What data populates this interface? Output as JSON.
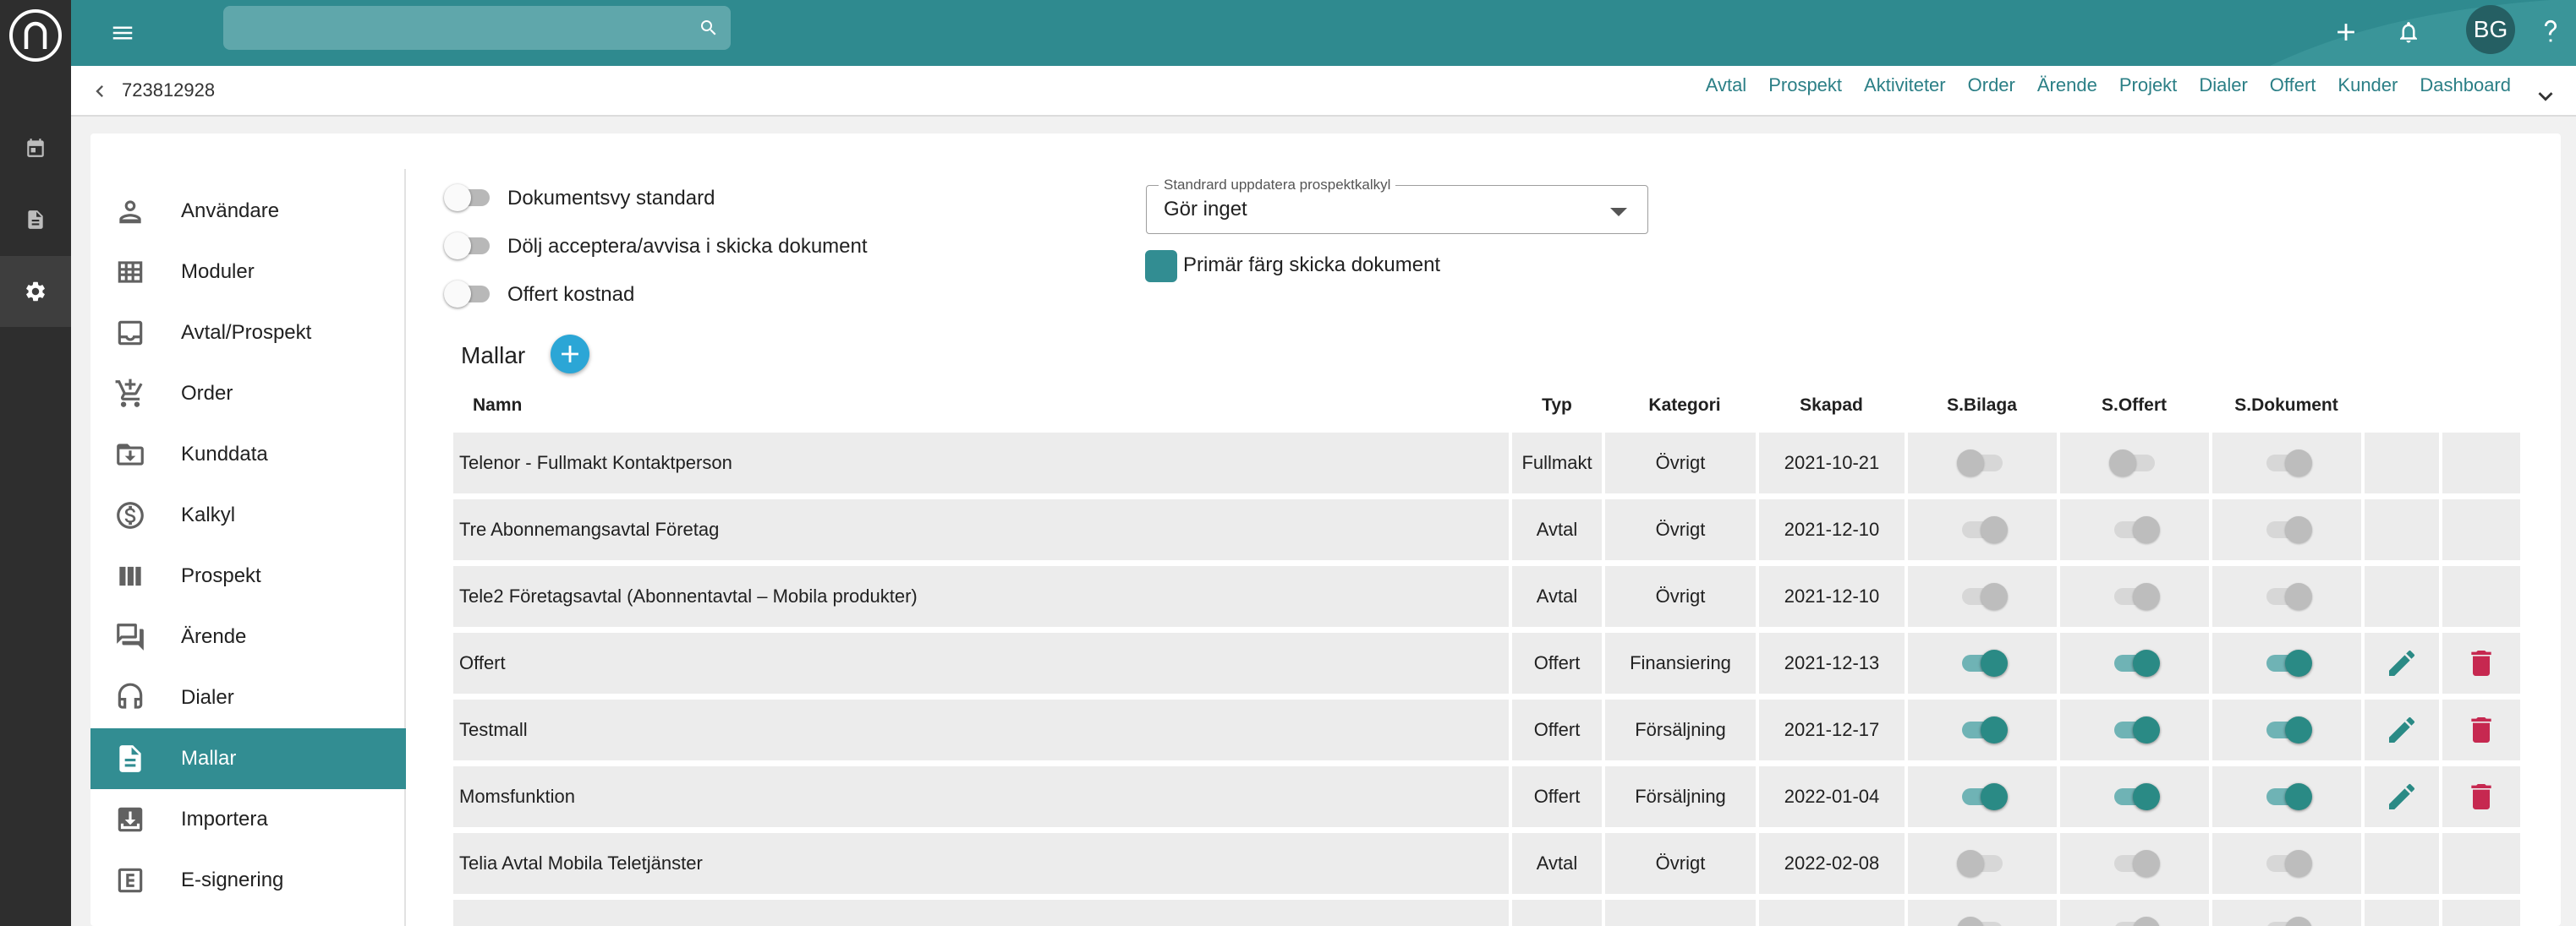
{
  "search": {
    "placeholder": ""
  },
  "user": {
    "initials": "BG"
  },
  "record": {
    "id": "723812928"
  },
  "nav_links": [
    "Avtal",
    "Prospekt",
    "Aktiviteter",
    "Order",
    "Ärende",
    "Projekt",
    "Dialer",
    "Offert",
    "Kunder",
    "Dashboard"
  ],
  "settings_nav": [
    {
      "label": "Användare",
      "icon": "person-icon"
    },
    {
      "label": "Moduler",
      "icon": "grid-icon"
    },
    {
      "label": "Avtal/Prospekt",
      "icon": "inbox-icon"
    },
    {
      "label": "Order",
      "icon": "cart-icon"
    },
    {
      "label": "Kunddata",
      "icon": "archive-icon"
    },
    {
      "label": "Kalkyl",
      "icon": "dollar-icon"
    },
    {
      "label": "Prospekt",
      "icon": "columns-icon"
    },
    {
      "label": "Ärende",
      "icon": "forum-icon"
    },
    {
      "label": "Dialer",
      "icon": "headset-icon"
    },
    {
      "label": "Mallar",
      "icon": "document-icon",
      "active": true
    },
    {
      "label": "Importera",
      "icon": "import-icon"
    },
    {
      "label": "E-signering",
      "icon": "e-box-icon"
    }
  ],
  "toggles": [
    {
      "label": "Dokumentsvy standard",
      "on": false
    },
    {
      "label": "Dölj acceptera/avvisa i skicka dokument",
      "on": false
    },
    {
      "label": "Offert kostnad",
      "on": false
    }
  ],
  "prospect_select": {
    "label": "Standrard uppdatera prospektkalkyl",
    "value": "Gör inget"
  },
  "primary_color": {
    "label": "Primär färg skicka dokument",
    "checked": true,
    "color": "#328d92"
  },
  "templates": {
    "title": "Mallar",
    "columns": [
      "Namn",
      "Typ",
      "Kategori",
      "Skapad",
      "S.Bilaga",
      "S.Offert",
      "S.Dokument"
    ],
    "rows": [
      {
        "name": "Telenor - Fullmakt Kontaktperson",
        "type": "Fullmakt",
        "category": "Övrigt",
        "created": "2021-10-21",
        "s_bilaga": "disabled-off",
        "s_offert": "disabled-off",
        "s_dokument": "disabled-on",
        "editable": false
      },
      {
        "name": "Tre Abonnemangsavtal Företag",
        "type": "Avtal",
        "category": "Övrigt",
        "created": "2021-12-10",
        "s_bilaga": "disabled-on",
        "s_offert": "disabled-on",
        "s_dokument": "disabled-on",
        "editable": false
      },
      {
        "name": "Tele2 Företagsavtal (Abonnentavtal – Mobila produkter)",
        "type": "Avtal",
        "category": "Övrigt",
        "created": "2021-12-10",
        "s_bilaga": "disabled-on",
        "s_offert": "disabled-on",
        "s_dokument": "disabled-on",
        "editable": false
      },
      {
        "name": "Offert",
        "type": "Offert",
        "category": "Finansiering",
        "created": "2021-12-13",
        "s_bilaga": "on",
        "s_offert": "on",
        "s_dokument": "on",
        "editable": true
      },
      {
        "name": "Testmall",
        "type": "Offert",
        "category": "Försäljning",
        "created": "2021-12-17",
        "s_bilaga": "on",
        "s_offert": "on",
        "s_dokument": "on",
        "editable": true
      },
      {
        "name": "Momsfunktion",
        "type": "Offert",
        "category": "Försäljning",
        "created": "2022-01-04",
        "s_bilaga": "on",
        "s_offert": "on",
        "s_dokument": "on",
        "editable": true
      },
      {
        "name": "Telia Avtal Mobila Teletjänster",
        "type": "Avtal",
        "category": "Övrigt",
        "created": "2022-02-08",
        "s_bilaga": "disabled-off",
        "s_offert": "disabled-on",
        "s_dokument": "disabled-on",
        "editable": false
      },
      {
        "name": "",
        "type": "",
        "category": "",
        "created": "",
        "s_bilaga": "disabled-off",
        "s_offert": "disabled-on",
        "s_dokument": "disabled-on",
        "editable": false
      }
    ]
  },
  "colors": {
    "topbar": "#2f8a8f",
    "accent": "#328d92",
    "edit": "#2a8a85",
    "delete": "#c62850",
    "add": "#2ba6d6"
  }
}
